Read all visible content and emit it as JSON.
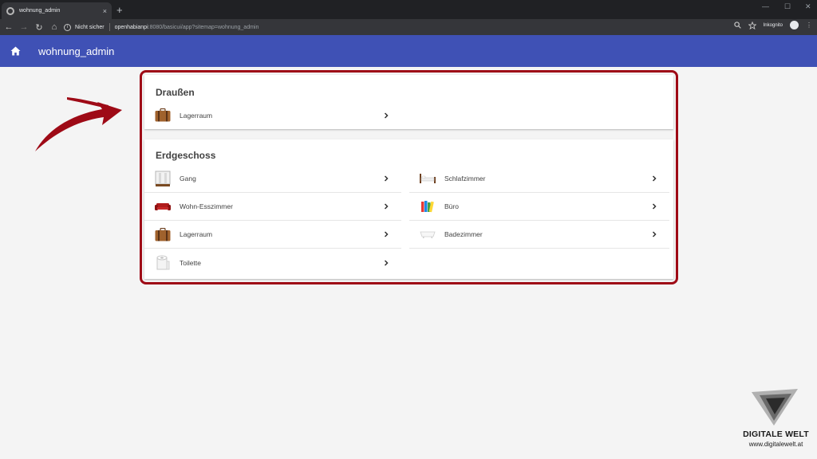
{
  "browser": {
    "tab_title": "wohnung_admin",
    "tab_close": "×",
    "new_tab": "+",
    "security_label": "Nicht sicher",
    "url_host": "openhabianpi",
    "url_rest": ":8080/basicui/app?sitemap=wohnung_admin",
    "profile_label": "Inkognito",
    "controls": {
      "minimize": "—",
      "maximize": "☐",
      "close": "✕",
      "menu": "⋮"
    }
  },
  "app": {
    "title": "wohnung_admin"
  },
  "sections": [
    {
      "title": "Draußen",
      "items": [
        {
          "label": "Lagerraum",
          "icon": "suitcase-icon"
        }
      ]
    },
    {
      "title": "Erdgeschoss",
      "items_left": [
        {
          "label": "Gang",
          "icon": "hallway-icon"
        },
        {
          "label": "Wohn-Esszimmer",
          "icon": "sofa-icon"
        },
        {
          "label": "Lagerraum",
          "icon": "suitcase-icon"
        },
        {
          "label": "Toilette",
          "icon": "toilet-paper-icon"
        }
      ],
      "items_right": [
        {
          "label": "Schlafzimmer",
          "icon": "bed-icon"
        },
        {
          "label": "Büro",
          "icon": "office-folders-icon"
        },
        {
          "label": "Badezimmer",
          "icon": "bathtub-icon"
        }
      ]
    }
  ],
  "watermark": {
    "brand": "DIGITALE WELT",
    "url": "www.digitalewelt.at"
  },
  "colors": {
    "appbar": "#3f51b5",
    "highlight": "#9e0a16",
    "background": "#f4f4f4"
  }
}
